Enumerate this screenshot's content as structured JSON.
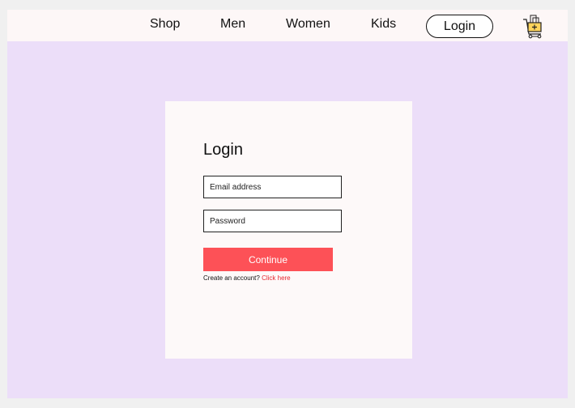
{
  "nav": {
    "links": [
      "Shop",
      "Men",
      "Women",
      "Kids"
    ],
    "login_label": "Login",
    "cart_icon": "shopping-cart-add-icon"
  },
  "login_form": {
    "title": "Login",
    "email_placeholder": "Email address",
    "password_placeholder": "Password",
    "continue_label": "Continue",
    "signup_prompt": "Create an account?",
    "signup_link": "Click here"
  },
  "colors": {
    "page_background": "#ecdef9",
    "navbar_background": "#fdf7f7",
    "card_background": "#fdf9f9",
    "primary_button": "#fd5157",
    "link": "#e8262e"
  }
}
